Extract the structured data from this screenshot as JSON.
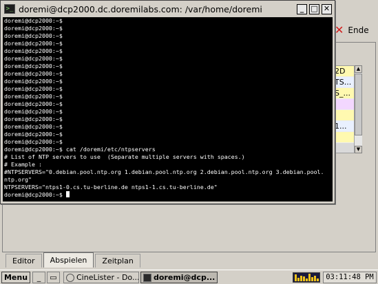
{
  "background_app": {
    "ende_label": "Ende",
    "list_cells": [
      "2D",
      "TS...",
      "S_...",
      "",
      "",
      "1...",
      "",
      ""
    ],
    "list_colors": [
      "#fff9b0",
      "#e9f0ff",
      "#fff9b0",
      "#f3d7ff",
      "#fff9b0",
      "#e9f0ff",
      "#fff9b0",
      "#d9d9d9"
    ],
    "tabs": [
      {
        "label": "Editor",
        "active": false
      },
      {
        "label": "Abspielen",
        "active": true
      },
      {
        "label": "Zeitplan",
        "active": false
      }
    ]
  },
  "terminal": {
    "title": "doremi@dcp2000.dc.doremilabs.com: /var/home/doremi",
    "title_icon": "terminal-icon",
    "buttons": {
      "minimize": "_",
      "maximize": "□",
      "close": "✕"
    },
    "lines": [
      "doremi@dcp2000:~$",
      "doremi@dcp2000:~$",
      "doremi@dcp2000:~$",
      "doremi@dcp2000:~$",
      "doremi@dcp2000:~$",
      "doremi@dcp2000:~$",
      "doremi@dcp2000:~$",
      "doremi@dcp2000:~$",
      "doremi@dcp2000:~$",
      "doremi@dcp2000:~$",
      "doremi@dcp2000:~$",
      "doremi@dcp2000:~$",
      "doremi@dcp2000:~$",
      "doremi@dcp2000:~$",
      "doremi@dcp2000:~$",
      "doremi@dcp2000:~$",
      "doremi@dcp2000:~$",
      "doremi@dcp2000:~$ cat /doremi/etc/ntpservers",
      "# List of NTP servers to use  (Separate multiple servers with spaces.)",
      "# Example :",
      "#NTPSERVERS=\"0.debian.pool.ntp.org 1.debian.pool.ntp.org 2.debian.pool.ntp.org 3.debian.pool.",
      "ntp.org\"",
      "NTPSERVERS=\"ntps1-0.cs.tu-berline.de ntps1-1.cs.tu-berline.de\"",
      "doremi@dcp2000:~$ "
    ]
  },
  "taskbar": {
    "menu_label": "Menu",
    "quick_buttons": [
      "_",
      "▭"
    ],
    "tasks": [
      {
        "label": "CineLister - Do...",
        "active": false
      },
      {
        "label": "doremi@dcp...",
        "active": true
      }
    ],
    "clock": "03:11:48 PM",
    "meter_levels": [
      0.85,
      0.4,
      0.7,
      0.55,
      0.3,
      0.9,
      0.5,
      0.65,
      0.35
    ]
  },
  "colors": {
    "terminal_bg": "#000000",
    "terminal_fg": "#ffffff",
    "ende_icon": "#d21a1a",
    "desktop_gray": "#d4d0c8"
  }
}
